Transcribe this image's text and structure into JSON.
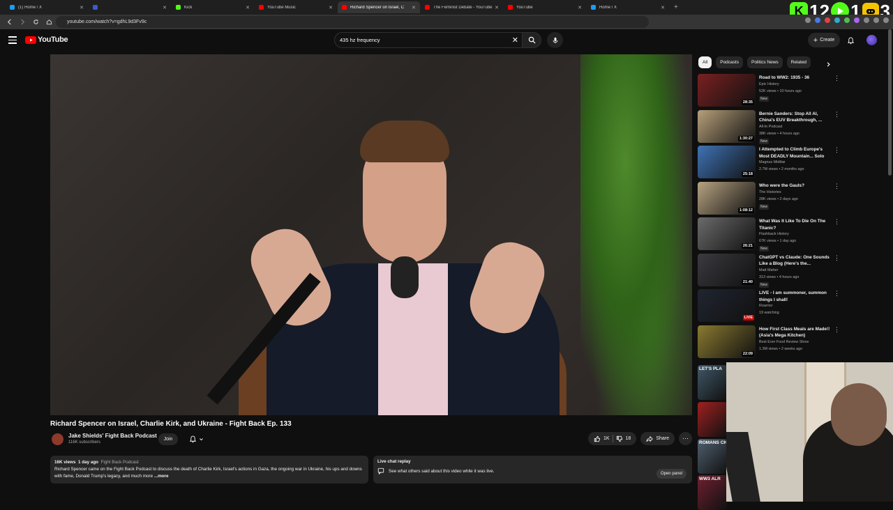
{
  "browser": {
    "tabs": [
      {
        "label": "(1) Home / X",
        "color": "#1d9bf0"
      },
      {
        "label": "",
        "color": "#3a5bd0"
      },
      {
        "label": "Kick",
        "color": "#53fc18"
      },
      {
        "label": "YouTube Music",
        "color": "#ff0000"
      },
      {
        "label": "Richard Spencer on Israel, C",
        "color": "#ff0000",
        "active": true
      },
      {
        "label": "The Feminist Debate - YouTube",
        "color": "#ff0000"
      },
      {
        "label": "YouTube",
        "color": "#ff0000"
      },
      {
        "label": "Home / X",
        "color": "#1d9bf0"
      }
    ],
    "url": "youtube.com/watch?v=gdhL9d3Fv9c"
  },
  "overlay": {
    "k_count": "12",
    "play_count": "1",
    "g_count": "3"
  },
  "header": {
    "logo": "YouTube",
    "search_value": "435 hz frequency",
    "create_label": "Create"
  },
  "video": {
    "title": "Richard Spencer on Israel, Charlie Kirk, and Ukraine - Fight Back Ep. 133",
    "channel": "Jake Shields' Fight Back Podcast",
    "subscribers": "116K subscribers",
    "join_label": "Join",
    "likes": "1K",
    "dislikes": "18",
    "share_label": "Share",
    "views": "16K views",
    "age": "1 day ago",
    "tag": "Fight Back Podcast",
    "description": "Richard Spencer came on the Fight Back Podcast to discuss the death of Charlie Kirk, Israel's actions in Gaza, the ongoing war in Ukraine, his ups and downs with fame, Donald Trump's legacy, and much more",
    "more_label": "...more"
  },
  "live_chat": {
    "heading": "Live chat replay",
    "text": "See what others said about this video while it was live.",
    "button": "Open panel"
  },
  "chips": [
    "All",
    "Podcasts",
    "Politics News",
    "Related"
  ],
  "recommendations": [
    {
      "title": "Road to WW2: 1935 - 36",
      "channel": "Epic History",
      "meta": "52K views • 10 hours ago",
      "new": "New",
      "duration": "28:35",
      "thumb": "#7a2020"
    },
    {
      "title": "Bernie Sanders: Stop All AI, China's EUV Breakthrough, ...",
      "channel": "All-In Podcast",
      "meta": "38K views • 4 hours ago",
      "new": "New",
      "duration": "1:30:27",
      "thumb": "#b7a07a"
    },
    {
      "title": "I Attempted to Climb Europe's Most DEADLY Mountain... Solo",
      "channel": "Magnus Midtbø",
      "meta": "2.7M views • 2 months ago",
      "new": "",
      "duration": "25:18",
      "thumb": "#3f73b5"
    },
    {
      "title": "Who were the Gauls?",
      "channel": "The Histories",
      "meta": "28K views • 2 days ago",
      "new": "New",
      "duration": "1:08:12",
      "thumb": "#b7a382"
    },
    {
      "title": "What Was It Like To Die On The Titanic?",
      "channel": "Flashback History",
      "meta": "67K views • 1 day ago",
      "new": "New",
      "duration": "26:21",
      "thumb": "#6b6b6b"
    },
    {
      "title": "ChatGPT vs Claude: One Sounds Like a Blog (Here's the...",
      "channel": "Matt Maher",
      "meta": "313 views • 4 hours ago",
      "new": "New",
      "duration": "21:40",
      "thumb": "#3a3a40"
    },
    {
      "title": "LIVE - I am summoner, summon things I shall!",
      "channel": "Roarrior",
      "meta": "19 watching",
      "new": "",
      "duration": "LIVE",
      "thumb": "#202530"
    },
    {
      "title": "How First Class Meals are Made!! (Asia's Mega Kitchen)",
      "channel": "Best Ever Food Review Show",
      "meta": "1.3M views • 2 weeks ago",
      "new": "",
      "duration": "22:09",
      "thumb": "#8a7a30"
    }
  ],
  "partial_thumbs": [
    {
      "label": "LET'S PLA",
      "color": "#405868"
    },
    {
      "label": "",
      "color": "#a02020"
    },
    {
      "label": "ROMANS CHAN",
      "color": "#506070"
    },
    {
      "label": "WW3 ALR",
      "color": "#702030"
    }
  ]
}
